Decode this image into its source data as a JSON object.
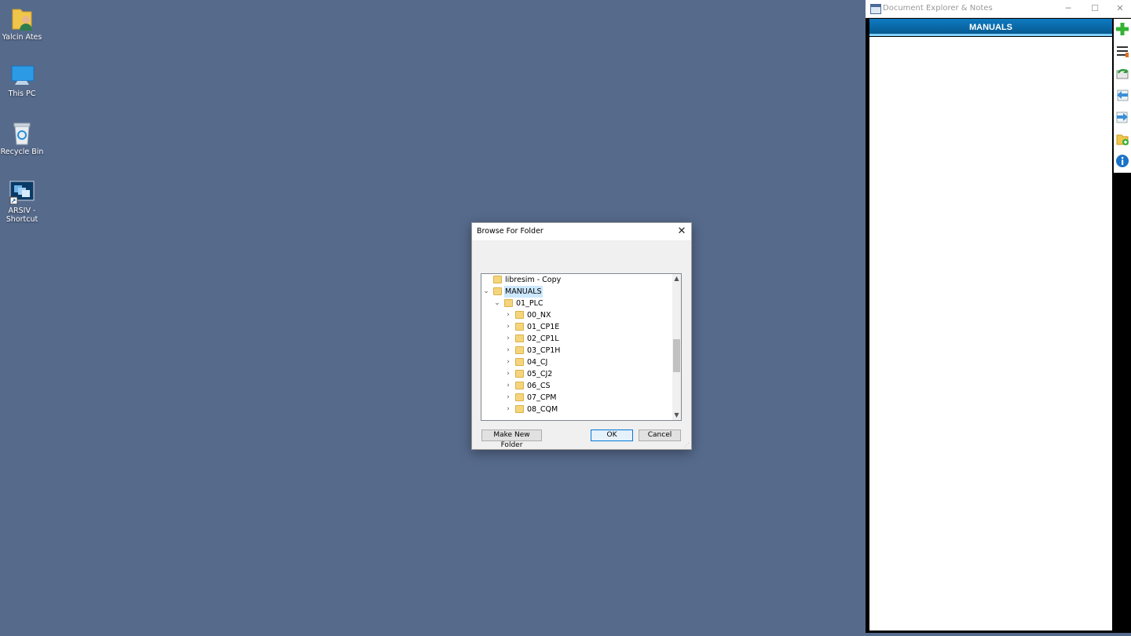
{
  "desktop": {
    "icons": [
      {
        "label": "Yalcin Ates",
        "icon": "user-folder-icon"
      },
      {
        "label": "This PC",
        "icon": "computer-icon"
      },
      {
        "label": "Recycle Bin",
        "icon": "recycle-bin-icon"
      },
      {
        "label": "ARSIV - Shortcut",
        "icon": "shortcut-icon"
      }
    ],
    "background_color": "#566a8c"
  },
  "doc_explorer": {
    "title": "Document Explorer & Notes",
    "header": "MANUALS",
    "controls": {
      "minimize": "─",
      "maximize": "☐",
      "close": "✕"
    },
    "tools": [
      "add-icon",
      "list-icon",
      "refresh-icon",
      "back-icon",
      "forward-icon",
      "folder-add-icon",
      "info-icon"
    ],
    "accent": "#0b6aa8"
  },
  "dialog": {
    "title": "Browse For Folder",
    "close": "✕",
    "tree": [
      {
        "label": "libresim - Copy",
        "level": 1,
        "chevron": ""
      },
      {
        "label": "MANUALS",
        "level": 1,
        "chevron": "⌄",
        "selected": true
      },
      {
        "label": "01_PLC",
        "level": 2,
        "chevron": "⌄"
      },
      {
        "label": "00_NX",
        "level": 3,
        "chevron": "›"
      },
      {
        "label": "01_CP1E",
        "level": 3,
        "chevron": "›"
      },
      {
        "label": "02_CP1L",
        "level": 3,
        "chevron": "›"
      },
      {
        "label": "03_CP1H",
        "level": 3,
        "chevron": "›"
      },
      {
        "label": "04_CJ",
        "level": 3,
        "chevron": "›"
      },
      {
        "label": "05_CJ2",
        "level": 3,
        "chevron": "›"
      },
      {
        "label": "06_CS",
        "level": 3,
        "chevron": "›"
      },
      {
        "label": "07_CPM",
        "level": 3,
        "chevron": "›"
      },
      {
        "label": "08_CQM",
        "level": 3,
        "chevron": "›"
      }
    ],
    "buttons": {
      "make_new_folder": "Make New Folder",
      "ok": "OK",
      "cancel": "Cancel"
    }
  }
}
